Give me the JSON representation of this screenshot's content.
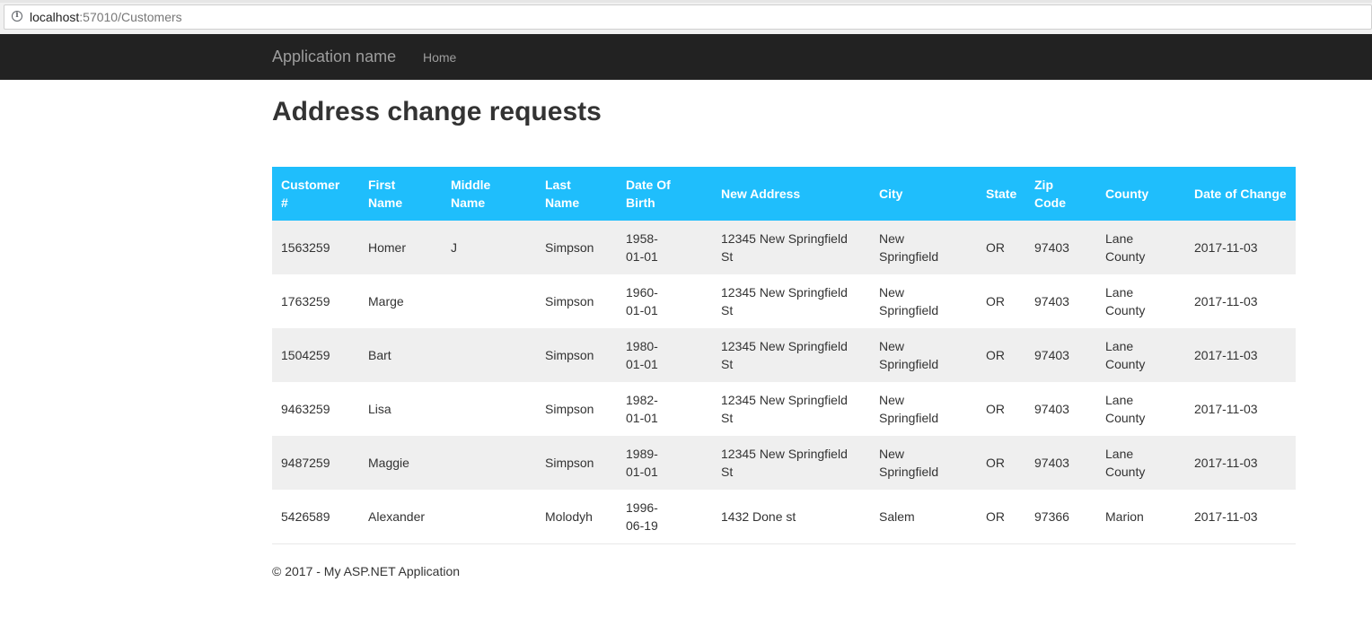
{
  "browser": {
    "url_host": "localhost",
    "url_path": ":57010/Customers",
    "info_icon": "info-icon"
  },
  "navbar": {
    "brand": "Application name",
    "links": [
      "Home"
    ]
  },
  "page": {
    "title": "Address change requests"
  },
  "table": {
    "headers": [
      "Customer #",
      "First Name",
      "Middle Name",
      "Last Name",
      "Date Of Birth",
      "New Address",
      "City",
      "State",
      "Zip Code",
      "County",
      "Date of Change"
    ],
    "rows": [
      [
        "1563259",
        "Homer",
        "J",
        "Simpson",
        "1958-01-01",
        "12345 New Springfield St",
        "New Springfield",
        "OR",
        "97403",
        "Lane County",
        "2017-11-03"
      ],
      [
        "1763259",
        "Marge",
        "",
        "Simpson",
        "1960-01-01",
        "12345 New Springfield St",
        "New Springfield",
        "OR",
        "97403",
        "Lane County",
        "2017-11-03"
      ],
      [
        "1504259",
        "Bart",
        "",
        "Simpson",
        "1980-01-01",
        "12345 New Springfield St",
        "New Springfield",
        "OR",
        "97403",
        "Lane County",
        "2017-11-03"
      ],
      [
        "9463259",
        "Lisa",
        "",
        "Simpson",
        "1982-01-01",
        "12345 New Springfield St",
        "New Springfield",
        "OR",
        "97403",
        "Lane County",
        "2017-11-03"
      ],
      [
        "9487259",
        "Maggie",
        "",
        "Simpson",
        "1989-01-01",
        "12345 New Springfield St",
        "New Springfield",
        "OR",
        "97403",
        "Lane County",
        "2017-11-03"
      ],
      [
        "5426589",
        "Alexander",
        "",
        "Molodyh",
        "1996-06-19",
        "1432 Done st",
        "Salem",
        "OR",
        "97366",
        "Marion",
        "2017-11-03"
      ]
    ]
  },
  "footer": {
    "text": "© 2017 - My ASP.NET Application"
  },
  "colors": {
    "navbar_bg": "#222222",
    "table_header_bg": "#1fbefc",
    "stripe_bg": "#efefef"
  }
}
